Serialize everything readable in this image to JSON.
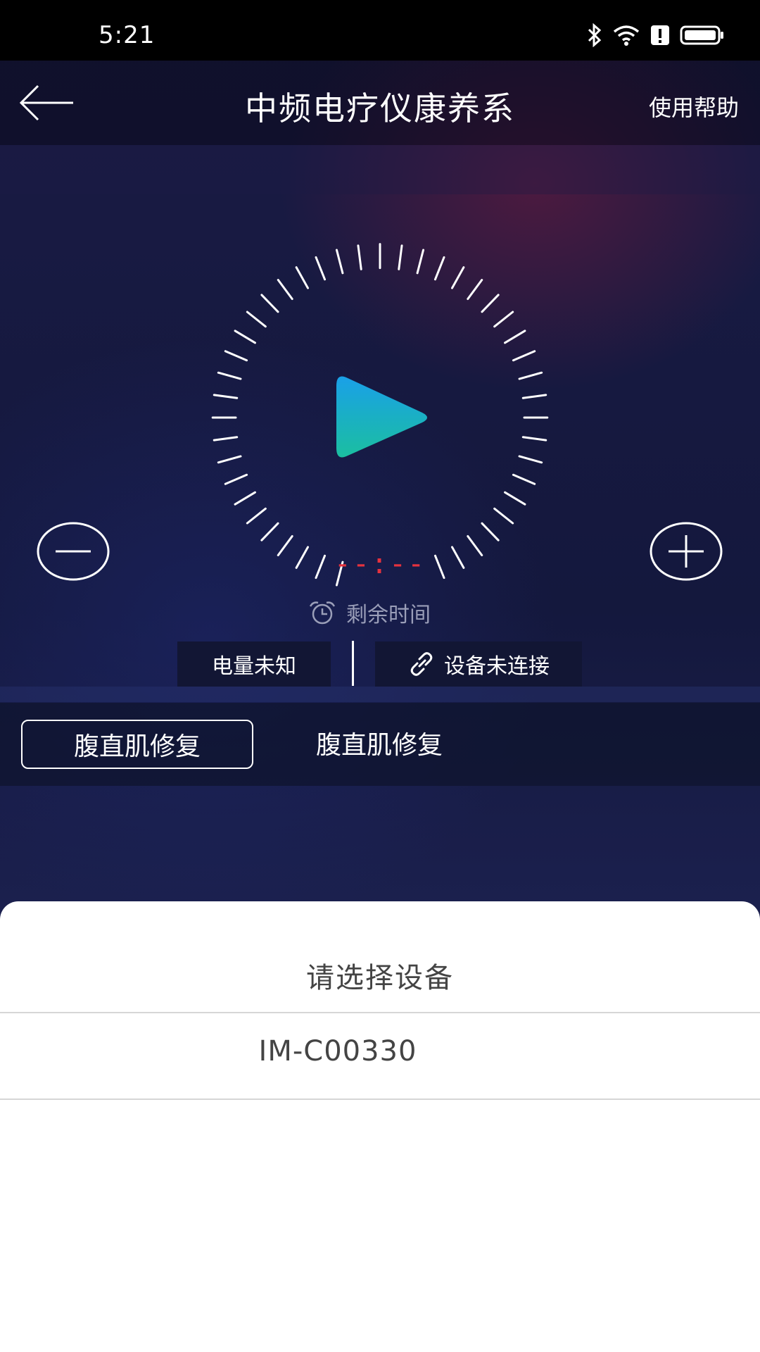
{
  "status_bar": {
    "time": "5:21",
    "icons": [
      "bluetooth-icon",
      "wifi-icon",
      "alert-icon",
      "battery-icon"
    ]
  },
  "nav": {
    "title": "中频电疗仪康养系",
    "help_label": "使用帮助"
  },
  "player": {
    "timer_text": "--:--",
    "remaining_label": "剩余时间",
    "battery_status": "电量未知",
    "connection_status": "设备未连接",
    "accent_colors": {
      "play_top": "#1aa0e8",
      "play_bottom": "#1bbfa0",
      "timer": "#e5323e"
    }
  },
  "modes": {
    "items": [
      {
        "label": "腹直肌修复",
        "selected": true
      },
      {
        "label": "腹直肌修复",
        "selected": false
      }
    ]
  },
  "device_sheet": {
    "title": "请选择设备",
    "devices": [
      "IM-C00330"
    ]
  }
}
